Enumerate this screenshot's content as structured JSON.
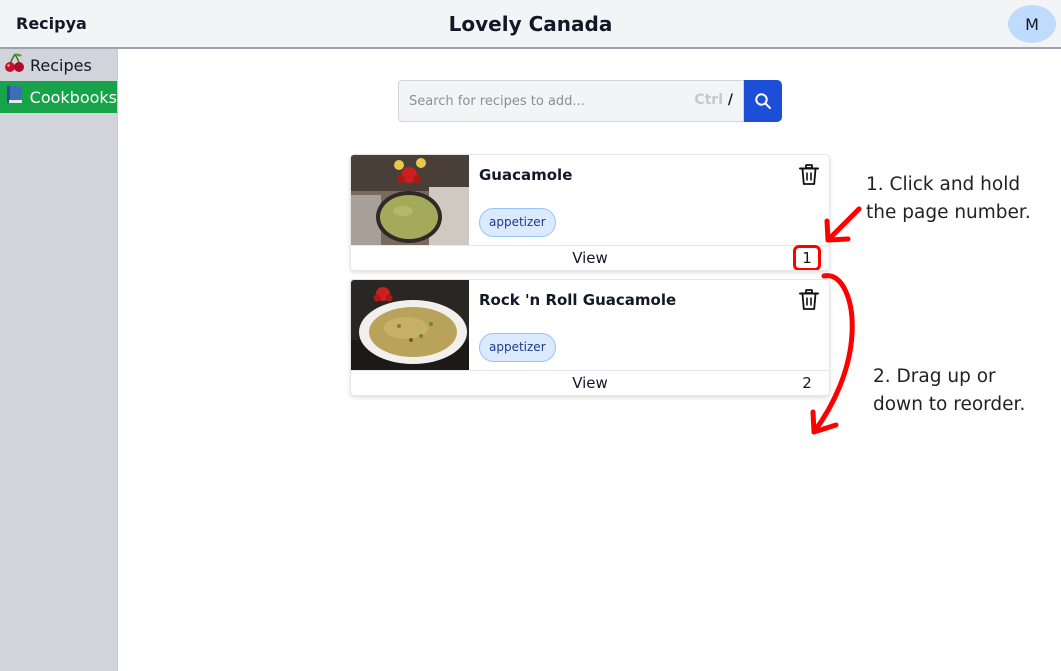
{
  "app": {
    "brand": "Recipya",
    "page_title": "Lovely Canada",
    "avatar_initial": "M"
  },
  "sidebar": {
    "items": [
      {
        "label": "Recipes",
        "icon": "cherries-icon",
        "active": false
      },
      {
        "label": "Cookbooks",
        "icon": "book-icon",
        "active": true
      }
    ]
  },
  "search": {
    "placeholder": "Search for recipes to add...",
    "value": "",
    "shortcut_ctrl": "Ctrl",
    "shortcut_key": "/"
  },
  "recipes": [
    {
      "title": "Guacamole",
      "tag": "appetizer",
      "view_label": "View",
      "page_number": "1"
    },
    {
      "title": "Rock 'n Roll Guacamole",
      "tag": "appetizer",
      "view_label": "View",
      "page_number": "2"
    }
  ],
  "annotations": {
    "step1": [
      "1. Click and hold",
      "the page number."
    ],
    "step2": [
      "2. Drag up or",
      "down to reorder."
    ]
  },
  "colors": {
    "accent": "#1d4ed8",
    "active_nav": "#16a34a",
    "annotation": "#ff0000",
    "tag_bg": "#dbeafe"
  }
}
